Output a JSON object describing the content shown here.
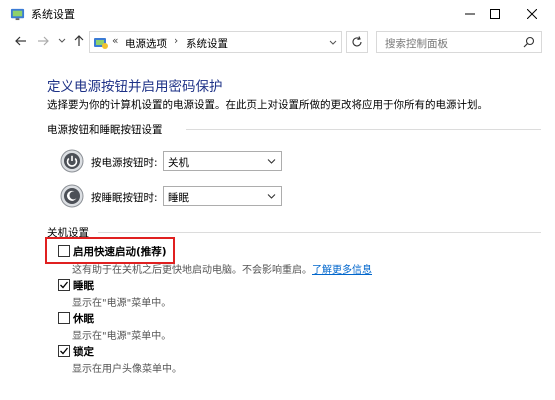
{
  "window": {
    "title": "系统设置"
  },
  "nav": {
    "breadcrumb_prefix": "«",
    "crumb1": "电源选项",
    "crumb_sep": "›",
    "crumb2": "系统设置",
    "search_placeholder": "搜索控制面板"
  },
  "page": {
    "heading": "定义电源按钮并启用密码保护",
    "description": "选择要为你的计算机设置的电源设置。在此页上对设置所做的更改将应用于你所有的电源计划。"
  },
  "buttons_group": {
    "header": "电源按钮和睡眠按钮设置",
    "power_label": "按电源按钮时:",
    "power_value": "关机",
    "sleep_label": "按睡眠按钮时:",
    "sleep_value": "睡眠"
  },
  "shutdown_group": {
    "header": "关机设置",
    "options": [
      {
        "label": "启用快速启动(推荐)",
        "checked": false,
        "desc": "这有助于在关机之后更快地启动电脑。不会影响重启。",
        "link": "了解更多信息"
      },
      {
        "label": "睡眠",
        "checked": true,
        "desc": "显示在\"电源\"菜单中。"
      },
      {
        "label": "休眠",
        "checked": false,
        "desc": "显示在\"电源\"菜单中。"
      },
      {
        "label": "锁定",
        "checked": true,
        "desc": "显示在用户头像菜单中。"
      }
    ]
  },
  "colors": {
    "heading": "#1e3287",
    "link": "#0066cc",
    "highlight": "#e02020"
  }
}
